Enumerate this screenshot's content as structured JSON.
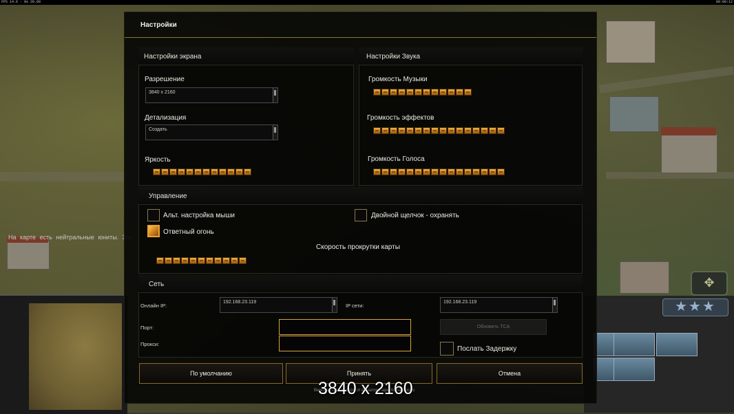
{
  "top_bar": {
    "left": "FPS 14.6 · 0s 20.00",
    "right": "00:00:12"
  },
  "world_notice": "На карте есть нейтральные юниты. Зах",
  "dialog": {
    "title": "Настройки",
    "screen": {
      "header": "Настройки экрана",
      "resolution_label": "Разрешение",
      "resolution_value": "3840 x 2160",
      "detail_label": "Детализация",
      "detail_value": "Создать",
      "brightness_label": "Яркость",
      "brightness_level": 12
    },
    "sound": {
      "header": "Настройки Звука",
      "music_label": "Громкость Музыки",
      "music_level": 12,
      "effects_label": "Громкость эффектов",
      "effects_level": 16,
      "voice_label": "Громкость Голоса",
      "voice_level": 16
    },
    "controls": {
      "header": "Управление",
      "alt_mouse_label": "Альт. настройка мыши",
      "alt_mouse_checked": false,
      "double_click_label": "Двойной щелчок - охранять",
      "double_click_checked": false,
      "return_fire_label": "Ответный огонь",
      "return_fire_checked": true,
      "scroll_speed_label": "Скорость прокрутки карты",
      "scroll_speed_level": 11
    },
    "network": {
      "header": "Сеть",
      "online_ip_label": "Онлайн IP:",
      "online_ip_value": "192.168.23.119",
      "lan_ip_label": "IP сети:",
      "lan_ip_value": "192.168.23.119",
      "port_label": "Порт:",
      "proxy_label": "Прокси:",
      "update_tca_label": "Обновить ТСА",
      "send_delay_label": "Послать Задержку",
      "send_delay_checked": false
    },
    "buttons": {
      "defaults": "По умолчанию",
      "accept": "Принять",
      "cancel": "Отмена"
    },
    "version_text": "Версия 1.04 · Ноябрь от фанатов Пары Командиров",
    "resolution_overlay": "3840 x 2160"
  },
  "hud": {
    "rank_stars": "★★★",
    "badge_icon": "compass-icon"
  },
  "colors": {
    "gold": "#d8a840",
    "bar_fill": "#c8821e",
    "panel_bg": "#050504"
  }
}
